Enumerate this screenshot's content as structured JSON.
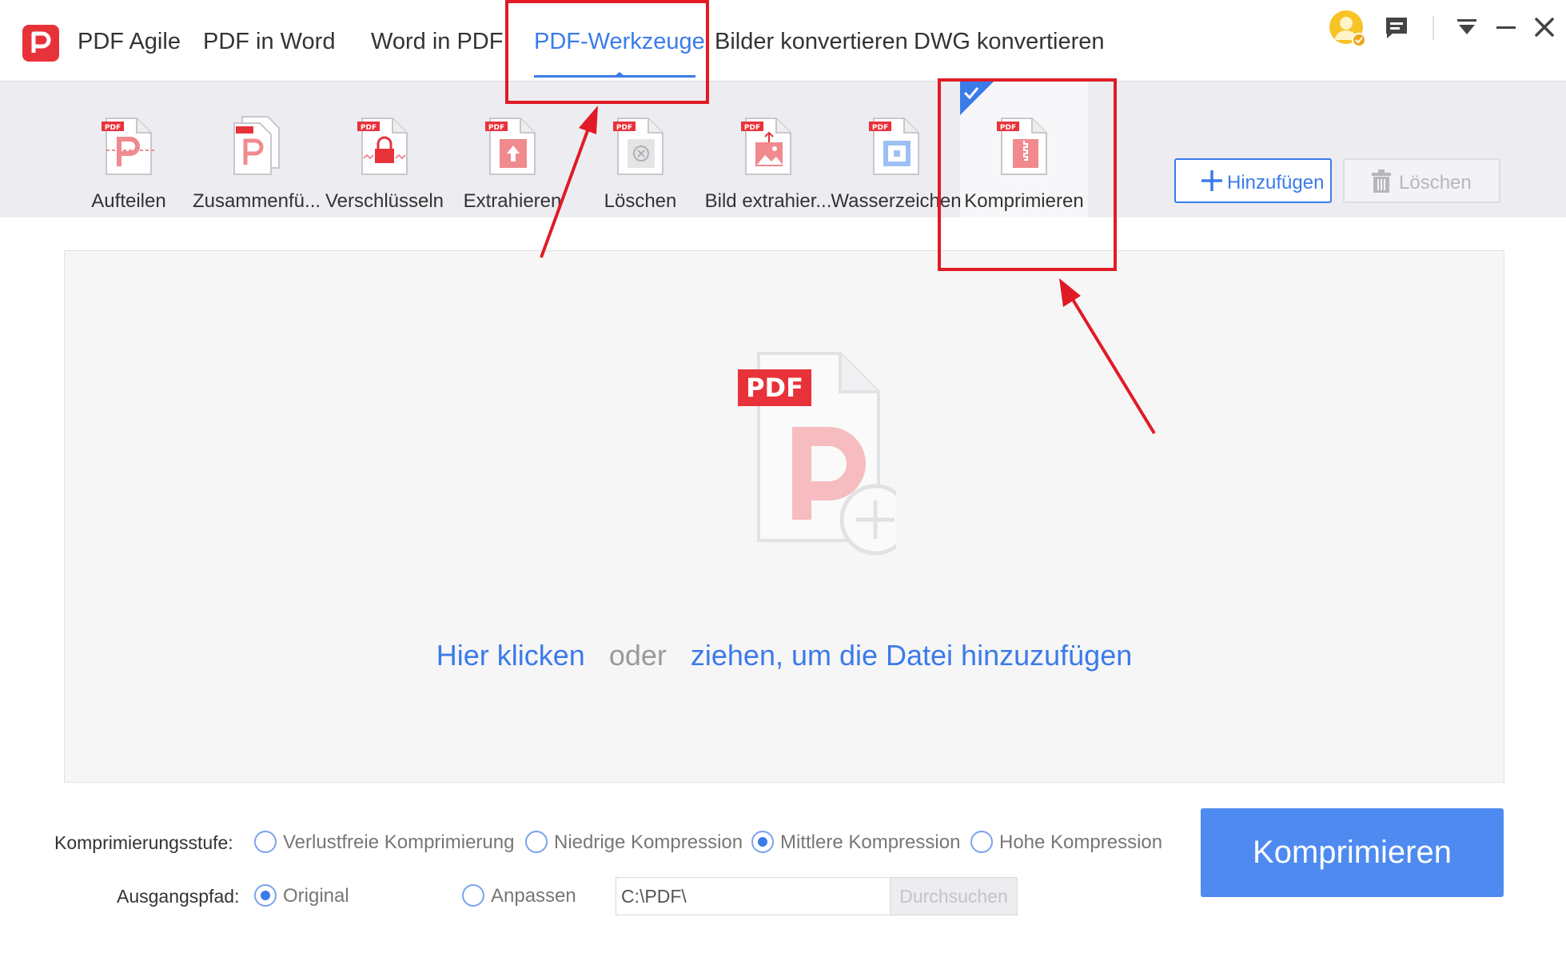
{
  "app": {
    "logo_icon": "pdf-agile-logo-icon",
    "brand_color": "#e8323a",
    "accent_color": "#3a7bea"
  },
  "tabs": [
    {
      "label": "PDF Agile"
    },
    {
      "label": "PDF in Word"
    },
    {
      "label": "Word in PDF"
    },
    {
      "label": "PDF-Werkzeuge",
      "active": true
    },
    {
      "label": "Bilder konvertieren"
    },
    {
      "label": "DWG konvertieren"
    }
  ],
  "window_controls": [
    "avatar-icon",
    "feedback-icon",
    "dropdown-menu-icon",
    "minimize-icon",
    "close-icon"
  ],
  "toolbar": {
    "tools": [
      {
        "label": "Aufteilen",
        "icon": "split-pdf-icon"
      },
      {
        "label": "Zusammenfü...",
        "icon": "merge-pdf-icon"
      },
      {
        "label": "Verschlüsseln",
        "icon": "encrypt-pdf-icon"
      },
      {
        "label": "Extrahieren",
        "icon": "extract-pages-icon"
      },
      {
        "label": "Löschen",
        "icon": "delete-pages-icon"
      },
      {
        "label": "Bild extrahier...",
        "icon": "extract-image-icon"
      },
      {
        "label": "Wasserzeichen",
        "icon": "watermark-icon"
      },
      {
        "label": "Komprimieren",
        "icon": "compress-pdf-icon",
        "selected": true
      }
    ],
    "add_button": "Hinzufügen",
    "delete_button": "Löschen"
  },
  "dropzone": {
    "icon": "pdf-add-file-icon",
    "badge": "PDF",
    "click_text": "Hier klicken",
    "or_text": "oder",
    "drag_text": "ziehen, um die Datei hinzuzufügen"
  },
  "compression": {
    "label": "Komprimierungsstufe:",
    "options": [
      {
        "label": "Verlustfreie Komprimierung",
        "checked": false
      },
      {
        "label": "Niedrige Kompression",
        "checked": false
      },
      {
        "label": "Mittlere Kompression",
        "checked": true
      },
      {
        "label": "Hohe Kompression",
        "checked": false
      }
    ]
  },
  "output": {
    "label": "Ausgangspfad:",
    "options": [
      {
        "label": "Original",
        "checked": true
      },
      {
        "label": "Anpassen",
        "checked": false
      }
    ],
    "path_value": "C:\\PDF\\",
    "browse_button": "Durchsuchen"
  },
  "compress_button": "Komprimieren",
  "annotation_color": "#e01b26"
}
